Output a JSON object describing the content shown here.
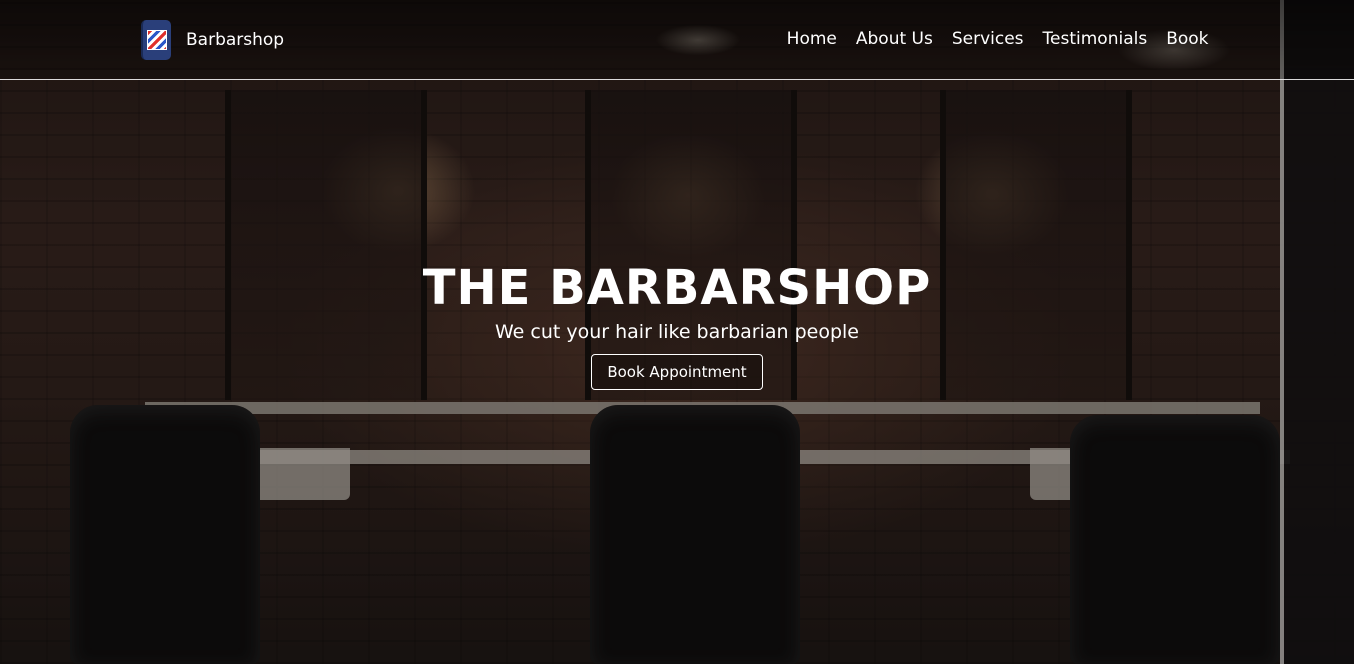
{
  "navbar": {
    "brand_icon": "barber-pole-icon",
    "brand_label": "Barbarshop",
    "links": [
      {
        "label": "Home"
      },
      {
        "label": "About Us"
      },
      {
        "label": "Services"
      },
      {
        "label": "Testimonials"
      },
      {
        "label": "Book"
      }
    ]
  },
  "hero": {
    "title": "THE BARBARSHOP",
    "subtitle": "We cut your hair like barbarian people",
    "cta_label": "Book Appointment"
  },
  "colors": {
    "text": "#ffffff",
    "overlay": "#0a0808",
    "pole_red": "#e0302b",
    "pole_blue": "#2b57c8",
    "icon_bg": "#2a3f7a"
  }
}
